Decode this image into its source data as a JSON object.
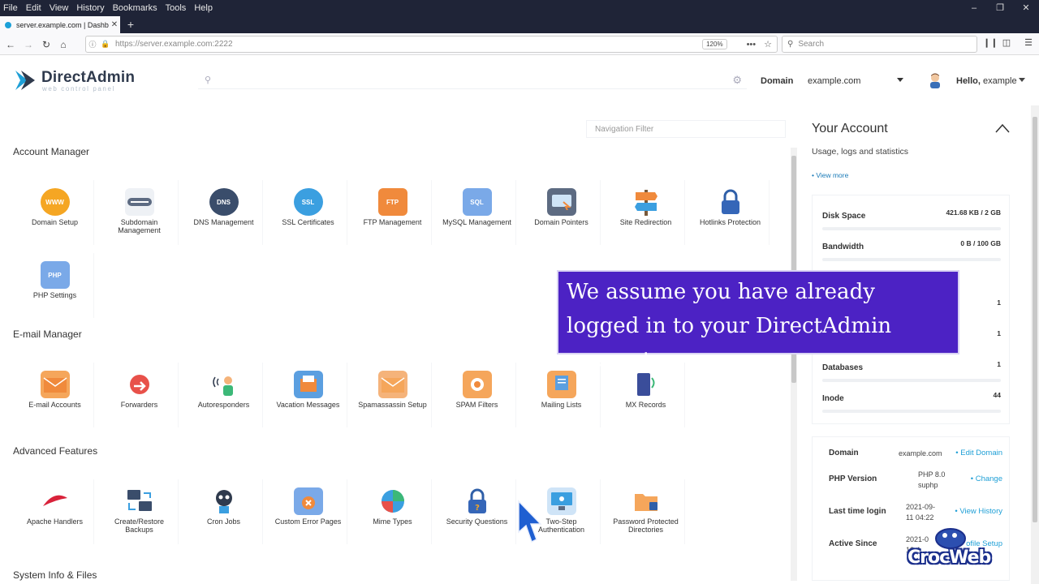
{
  "browser": {
    "menu": [
      "File",
      "Edit",
      "View",
      "History",
      "Bookmarks",
      "Tools",
      "Help"
    ],
    "tab_title": "server.example.com | Dashboa",
    "url": "https://server.example.com:2222",
    "zoom": "120%",
    "search_placeholder": "Search"
  },
  "header": {
    "brand": "DirectAdmin",
    "brand_sub": "web control panel",
    "domain_label": "Domain",
    "domain_value": "example.com",
    "hello_prefix": "Hello,",
    "hello_user": "example"
  },
  "nav_filter_placeholder": "Navigation Filter",
  "sections": {
    "account_manager": {
      "title": "Account Manager",
      "items": [
        "Domain Setup",
        "Subdomain Management",
        "DNS Management",
        "SSL Certificates",
        "FTP Management",
        "MySQL Management",
        "Domain Pointers",
        "Site Redirection",
        "Hotlinks Protection",
        "PHP Settings"
      ]
    },
    "email_manager": {
      "title": "E-mail Manager",
      "items": [
        "E-mail Accounts",
        "Forwarders",
        "Autoresponders",
        "Vacation Messages",
        "Spamassassin Setup",
        "SPAM Filters",
        "Mailing Lists",
        "MX Records"
      ]
    },
    "advanced": {
      "title": "Advanced Features",
      "items": [
        "Apache Handlers",
        "Create/Restore Backups",
        "Cron Jobs",
        "Custom Error Pages",
        "Mime Types",
        "Security Questions",
        "Two-Step Authentication",
        "Password Protected Directories"
      ]
    },
    "system": {
      "title": "System Info & Files"
    }
  },
  "icon_text": {
    "www": "WWW",
    "dns": "DNS",
    "ssl": "SSL",
    "ftp": "FTP",
    "sql": "SQL",
    "php": "PHP"
  },
  "account": {
    "title": "Your Account",
    "subtitle": "Usage, logs and statistics",
    "view_more": "• View more",
    "stats": [
      {
        "name": "Disk Space",
        "value": "421.68 KB / 2 GB"
      },
      {
        "name": "Bandwidth",
        "value": "0 B / 100 GB"
      },
      {
        "name": "",
        "value": "1"
      },
      {
        "name": "",
        "value": "1"
      },
      {
        "name": "Databases",
        "value": "1"
      },
      {
        "name": "Inode",
        "value": "44"
      }
    ],
    "info": [
      {
        "key": "Domain",
        "value": "example.com",
        "action": "• Edit Domain"
      },
      {
        "key": "PHP Version",
        "value": "PHP 8.0 suphp",
        "action": "• Change"
      },
      {
        "key": "Last time login",
        "value": "2021-09-11 04:22",
        "action": "• View History"
      },
      {
        "key": "Active Since",
        "value": "2021-0 12:4",
        "action": "ofile Setup"
      }
    ]
  },
  "caption": "We assume you have already logged in to your DirectAdmin account.",
  "watermark": "CrocWeb",
  "colors": {
    "accent": "#1e9fd6",
    "caption_bg": "#4c22c4",
    "chrome_dark": "#1f2437"
  }
}
